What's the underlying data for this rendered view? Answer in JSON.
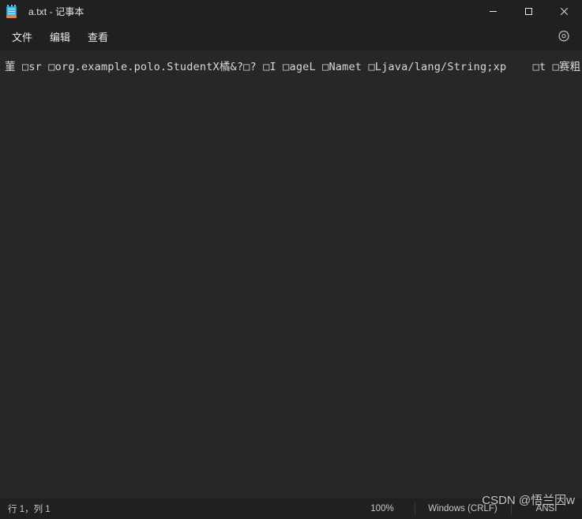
{
  "window": {
    "title": "a.txt - 记事本",
    "icon": "notepad-icon",
    "controls": {
      "minimize_label": "最小化",
      "maximize_label": "最大化",
      "close_label": "关闭"
    }
  },
  "menubar": {
    "items": [
      {
        "label": "文件",
        "name": "menu-file"
      },
      {
        "label": "编辑",
        "name": "menu-edit"
      },
      {
        "label": "查看",
        "name": "menu-view"
      }
    ],
    "settings_icon": "gear-icon"
  },
  "editor": {
    "content": "菫 □sr □org.example.polo.StudentX橘&?□? □I □ageL □Namet □Ljava/lang/String;xp    □t □赛粗"
  },
  "statusbar": {
    "cursor_position": "行 1，列 1",
    "zoom": "100%",
    "line_ending": "Windows (CRLF)",
    "encoding": "ANSI"
  },
  "watermark": {
    "text": "CSDN @悟兰因w"
  },
  "colors": {
    "chrome_background": "#202020",
    "editor_background": "#272727",
    "text_primary": "#e8e8e8",
    "editor_text": "#d8d8d8",
    "status_text": "#c9c9c9",
    "separator": "#3d3d3d",
    "icon_blue": "#4cb3e0",
    "icon_orange": "#d9893f",
    "close_hover": "#c42b1c"
  }
}
